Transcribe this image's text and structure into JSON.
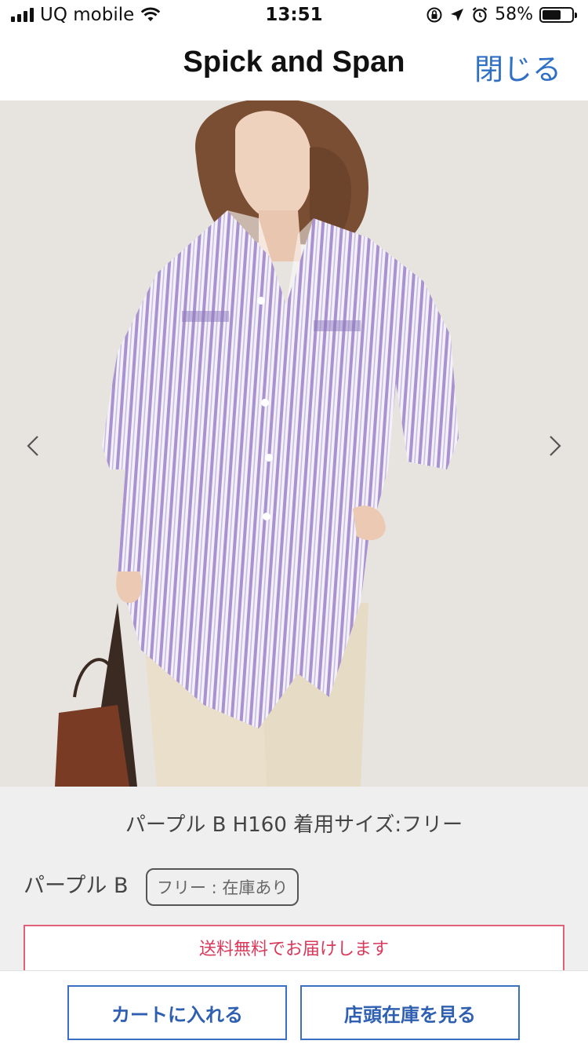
{
  "status_bar": {
    "carrier": "UQ mobile",
    "time": "13:51",
    "battery": "58%",
    "icons": [
      "signal-icon",
      "wifi-icon",
      "rotation-lock-icon",
      "location-icon",
      "alarm-icon",
      "battery-icon"
    ]
  },
  "nav": {
    "title": "Spick and Span",
    "close_label": "閉じる"
  },
  "product": {
    "image_caption": "パープル B H160 着用サイズ:フリー",
    "color_name": "パープル B",
    "size_option": "フリー : 在庫あり",
    "shipping_notice": "送料無料でお届けします"
  },
  "actions": {
    "add_to_cart": "カートに入れる",
    "store_stock": "店頭在庫を見る"
  },
  "colors": {
    "accent_blue": "#2f6fc4",
    "notice_red": "#d9395b",
    "shirt_stripe": "#9c86c9"
  }
}
